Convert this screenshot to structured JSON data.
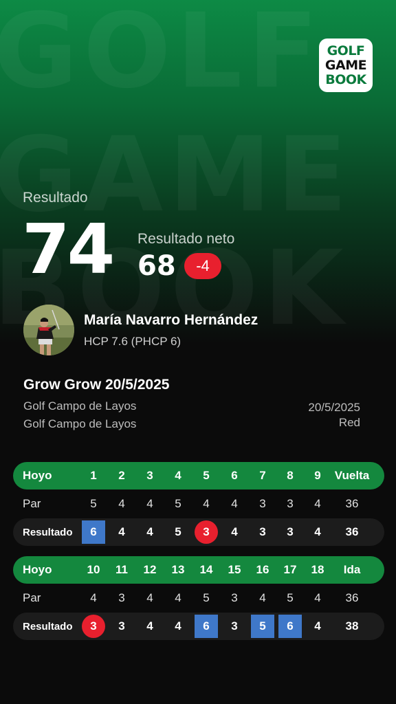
{
  "brand": {
    "logo_line1": "GOLF",
    "logo_line2": "GAME",
    "logo_line3": "BOOK",
    "watermark_line1": "GOLF",
    "watermark_line2": "GAME",
    "watermark_line3": "BOOK"
  },
  "summary": {
    "result_label": "Resultado",
    "gross": "74",
    "net_label": "Resultado neto",
    "net": "68",
    "to_par": "-4"
  },
  "player": {
    "name": "María Navarro Hernández",
    "hcp": "HCP 7.6 (PHCP 6)"
  },
  "round": {
    "title": "Grow Grow 20/5/2025",
    "course_line1": "Golf Campo de Layos",
    "course_line2": "Golf Campo de Layos",
    "date": "20/5/2025",
    "tee": "Red"
  },
  "scorecard": {
    "front": {
      "hole_label": "Hoyo",
      "holes": [
        "1",
        "2",
        "3",
        "4",
        "5",
        "6",
        "7",
        "8",
        "9"
      ],
      "total_label": "Vuelta",
      "par_label": "Par",
      "par": [
        "5",
        "4",
        "4",
        "5",
        "4",
        "4",
        "3",
        "3",
        "4"
      ],
      "par_total": "36",
      "score_label": "Resultado",
      "scores": [
        "6",
        "4",
        "4",
        "5",
        "3",
        "4",
        "3",
        "3",
        "4"
      ],
      "score_total": "36"
    },
    "back": {
      "hole_label": "Hoyo",
      "holes": [
        "10",
        "11",
        "12",
        "13",
        "14",
        "15",
        "16",
        "17",
        "18"
      ],
      "total_label": "Ida",
      "par_label": "Par",
      "par": [
        "4",
        "3",
        "4",
        "4",
        "5",
        "3",
        "4",
        "5",
        "4"
      ],
      "par_total": "36",
      "score_label": "Resultado",
      "scores": [
        "3",
        "3",
        "4",
        "4",
        "6",
        "3",
        "5",
        "6",
        "4"
      ],
      "score_total": "38"
    }
  },
  "colors": {
    "accent_green": "#14883e",
    "birdie_red": "#e8202e",
    "bogey_blue": "#3f78c9"
  }
}
